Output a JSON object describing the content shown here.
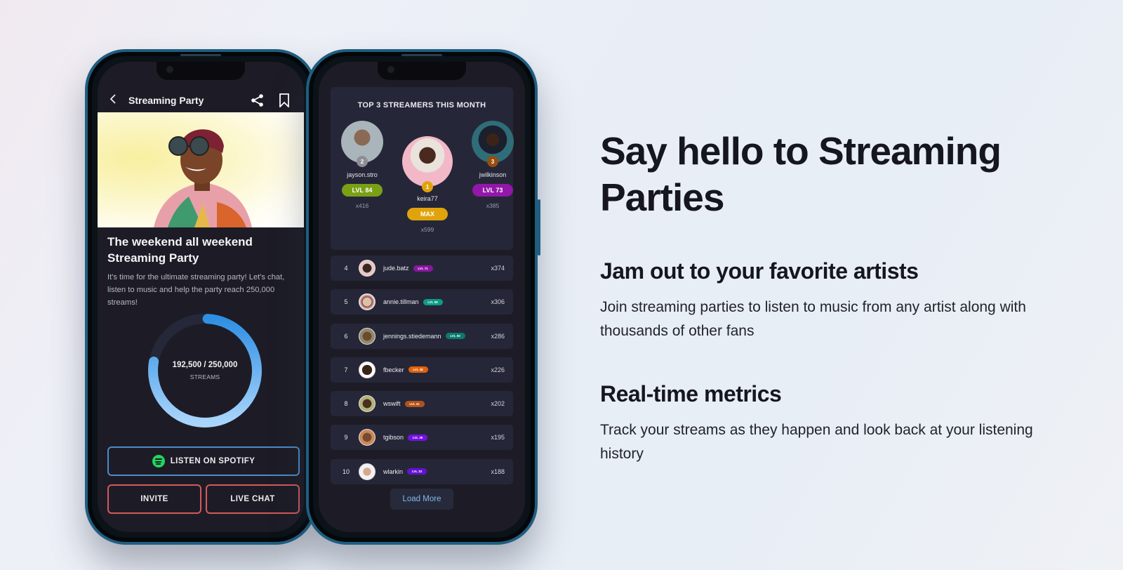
{
  "left_phone": {
    "header": {
      "back_icon": "chevron-left-icon",
      "title": "Streaming Party",
      "share_icon": "share-icon",
      "bookmark_icon": "bookmark-icon"
    },
    "hero_image": "artist-photo",
    "event": {
      "title": "The weekend all weekend Streaming Party",
      "description": "It's time for the ultimate streaming party! Let's chat, listen to music and help the party reach 250,000 streams!"
    },
    "progress": {
      "count_text": "192,500 / 250,000",
      "label": "STREAMS",
      "current": 192500,
      "goal": 250000,
      "fraction": 0.77,
      "color_start": "#2f8fe4",
      "color_end": "#a9d5fb",
      "track_color": "#252838"
    },
    "buttons": {
      "spotify": "LISTEN ON SPOTIFY",
      "spotify_icon": "spotify-icon",
      "invite": "INVITE",
      "live_chat": "LIVE CHAT"
    }
  },
  "right_phone": {
    "top3": {
      "title": "TOP 3 STREAMERS THIS MONTH",
      "streamers": [
        {
          "rank": "2",
          "name": "jayson.stro",
          "level": "LVL 84",
          "score": "x416",
          "level_color": "#7aa016",
          "rank_color": "#8e8e96"
        },
        {
          "rank": "1",
          "name": "keira77",
          "level": "MAX",
          "score": "x599",
          "level_color": "#e0a30c",
          "rank_color": "#e0a30c"
        },
        {
          "rank": "3",
          "name": "jwilkinson",
          "level": "LVL 73",
          "score": "x385",
          "level_color": "#9317a8",
          "rank_color": "#9a4d0e"
        }
      ]
    },
    "leaderboard": [
      {
        "rank": "4",
        "name": "jude.batz",
        "level": "LVL 71",
        "score": "x374",
        "level_color": "#8a17a0"
      },
      {
        "rank": "5",
        "name": "annie.tillman",
        "level": "LVL 59",
        "score": "x306",
        "level_color": "#0e9b87"
      },
      {
        "rank": "6",
        "name": "jennings.stiedemann",
        "level": "LVL 50",
        "score": "x286",
        "level_color": "#0c7a6f"
      },
      {
        "rank": "7",
        "name": "fbecker",
        "level": "LVL 48",
        "score": "x226",
        "level_color": "#e0620c"
      },
      {
        "rank": "8",
        "name": "wswift",
        "level": "LVL 41",
        "score": "x202",
        "level_color": "#b2521a"
      },
      {
        "rank": "9",
        "name": "tgibson",
        "level": "LVL 39",
        "score": "x195",
        "level_color": "#7510e8"
      },
      {
        "rank": "10",
        "name": "wlarkin",
        "level": "LVL 33",
        "score": "x188",
        "level_color": "#6412d4"
      }
    ],
    "load_more": "Load More"
  },
  "marketing": {
    "headline": "Say hello to Streaming Parties",
    "features": [
      {
        "title": "Jam out to your favorite artists",
        "body": "Join streaming parties to listen to music from any artist along with thousands of other fans"
      },
      {
        "title": "Real-time metrics",
        "body": "Track your streams as they happen and look back at your listening history"
      }
    ]
  }
}
